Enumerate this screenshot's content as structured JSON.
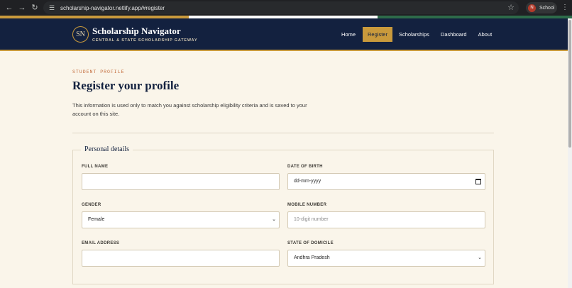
{
  "browser": {
    "url": "scholarship-navigator.netlify.app/#register",
    "profile_initial": "N",
    "profile_name": "School",
    "icons": {
      "back": "arrow-left-icon",
      "forward": "arrow-right-icon",
      "reload": "reload-icon",
      "site_info": "tune-icon",
      "bookmark": "star-icon",
      "menu": "kebab-menu-icon"
    }
  },
  "header": {
    "logo_text": "SN",
    "title": "Scholarship Navigator",
    "subtitle": "CENTRAL & STATE SCHOLARSHIP GATEWAY",
    "nav": [
      {
        "label": "Home"
      },
      {
        "label": "Register",
        "active": true
      },
      {
        "label": "Scholarships"
      },
      {
        "label": "Dashboard"
      },
      {
        "label": "About"
      }
    ]
  },
  "page": {
    "eyebrow": "STUDENT PROFILE",
    "title": "Register your profile",
    "intro": "This information is used only to match you against scholarship eligibility criteria and is saved to your account on this site."
  },
  "form": {
    "section_title": "Personal details",
    "full_name": {
      "label": "FULL NAME",
      "value": ""
    },
    "dob": {
      "label": "DATE OF BIRTH",
      "placeholder": "dd-mm-yyyy"
    },
    "gender": {
      "label": "GENDER",
      "value": "Female"
    },
    "mobile": {
      "label": "MOBILE NUMBER",
      "placeholder": "10-digit number"
    },
    "email": {
      "label": "EMAIL ADDRESS",
      "value": ""
    },
    "state": {
      "label": "STATE OF DOMICILE",
      "value": "Andhra Pradesh"
    }
  },
  "colors": {
    "navy": "#13213f",
    "gold": "#c99a3c",
    "cream": "#faf5ea",
    "eyebrow": "#c26a3a"
  }
}
